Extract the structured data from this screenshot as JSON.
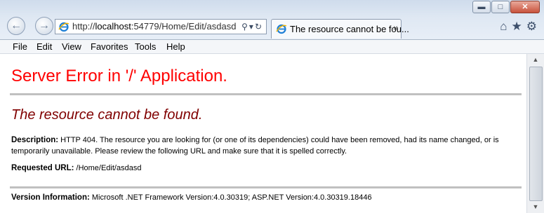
{
  "window": {
    "controls": {
      "minimize": "▬",
      "maximize": "□",
      "close": "✕"
    }
  },
  "toolbar": {
    "back_icon": "back-arrow-icon",
    "forward_icon": "forward-arrow-icon",
    "address_prefix": "http://",
    "address_host": "localhost",
    "address_rest": ":54779/Home/Edit/asdasd",
    "search_glyph": "⚲",
    "refresh_glyph": "↻",
    "dropdown_glyph": "▾",
    "home_glyph": "⌂",
    "favorites_glyph": "★",
    "settings_glyph": "⚙"
  },
  "tab": {
    "title": "The resource cannot be fou...",
    "close": "×"
  },
  "menu": {
    "items": [
      "File",
      "Edit",
      "View",
      "Favorites",
      "Tools",
      "Help"
    ]
  },
  "page": {
    "heading": "Server Error in '/' Application.",
    "subheading": "The resource cannot be found.",
    "description_label": "Description:",
    "description_text": "HTTP 404. The resource you are looking for (or one of its dependencies) could have been removed, had its name changed, or is temporarily unavailable.  Please review the following URL and make sure that it is spelled correctly.",
    "requested_url_label": "Requested URL:",
    "requested_url_value": "/Home/Edit/asdasd",
    "version_label": "Version Information:",
    "version_value": "Microsoft .NET Framework Version:4.0.30319; ASP.NET Version:4.0.30319.18446"
  },
  "colors": {
    "heading": "#ff0000",
    "subheading": "#800000",
    "rule": "#c0c0c0"
  }
}
